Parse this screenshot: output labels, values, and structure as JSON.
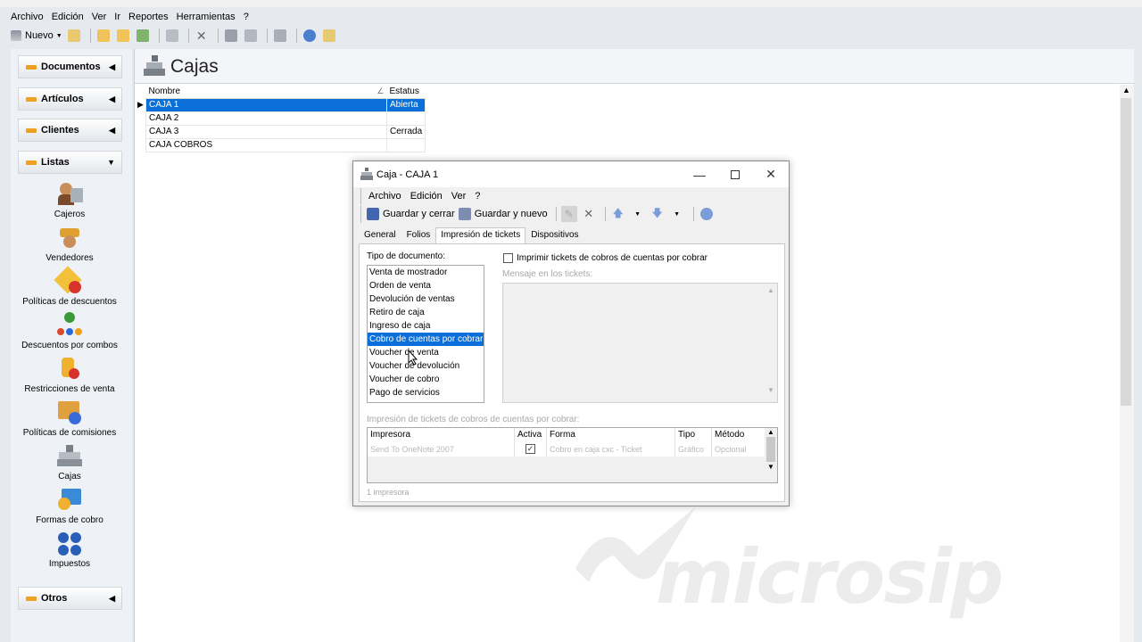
{
  "menubar": [
    {
      "label": "Archivo"
    },
    {
      "label": "Edición"
    },
    {
      "label": "Ver"
    },
    {
      "label": "Ir"
    },
    {
      "label": "Reportes"
    },
    {
      "label": "Herramientas"
    },
    {
      "label": "?"
    }
  ],
  "toolbar": {
    "new_label": "Nuevo"
  },
  "sidebar": {
    "groups": [
      {
        "label": "Documentos"
      },
      {
        "label": "Artículos"
      },
      {
        "label": "Clientes"
      },
      {
        "label": "Listas"
      },
      {
        "label": "Otros"
      }
    ],
    "items": [
      {
        "label": "Cajeros"
      },
      {
        "label": "Vendedores"
      },
      {
        "label": "Políticas de descuentos"
      },
      {
        "label": "Descuentos por combos"
      },
      {
        "label": "Restricciones de venta"
      },
      {
        "label": "Políticas de comisiones"
      },
      {
        "label": "Cajas"
      },
      {
        "label": "Formas de cobro"
      },
      {
        "label": "Impuestos"
      }
    ]
  },
  "main": {
    "title": "Cajas",
    "columns": [
      "Nombre",
      "Estatus"
    ],
    "rows": [
      {
        "name": "CAJA 1",
        "status": "Abierta"
      },
      {
        "name": "CAJA 2",
        "status": ""
      },
      {
        "name": "CAJA 3",
        "status": "Cerrada"
      },
      {
        "name": "CAJA COBROS",
        "status": ""
      }
    ]
  },
  "dialog": {
    "title": "Caja - CAJA 1",
    "menu": [
      {
        "label": "Archivo"
      },
      {
        "label": "Edición"
      },
      {
        "label": "Ver"
      },
      {
        "label": "?"
      }
    ],
    "save_close": "Guardar y cerrar",
    "save_new": "Guardar y nuevo",
    "tabs": [
      {
        "label": "General"
      },
      {
        "label": "Folios"
      },
      {
        "label": "Impresión de tickets"
      },
      {
        "label": "Dispositivos"
      }
    ],
    "doc_type_label": "Tipo de documento:",
    "doc_types": [
      {
        "label": "Venta de mostrador"
      },
      {
        "label": "Orden de venta"
      },
      {
        "label": "Devolución de ventas"
      },
      {
        "label": "Retiro de caja"
      },
      {
        "label": "Ingreso de caja"
      },
      {
        "label": "Cobro de cuentas por cobrar"
      },
      {
        "label": "Voucher de venta"
      },
      {
        "label": "Voucher de devolución"
      },
      {
        "label": "Voucher de cobro"
      },
      {
        "label": "Pago de servicios"
      }
    ],
    "print_checkbox": "Imprimir tickets de cobros de cuentas por cobrar",
    "message_label": "Mensaje en los tickets:",
    "printers_label": "Impresión de tickets de cobros de cuentas por cobrar:",
    "printer_columns": [
      "Impresora",
      "Activa",
      "Forma",
      "Tipo",
      "Método"
    ],
    "printer_row": {
      "printer": "Send To OneNote 2007",
      "form": "Cobro en caja cxc - Ticket",
      "type": "Gráfico",
      "method": "Opcional"
    },
    "printer_count": "1 impresora"
  },
  "watermark": "microsip",
  "colors": {
    "selection": "#0a6fd8",
    "group_bar": "#f0a020"
  }
}
